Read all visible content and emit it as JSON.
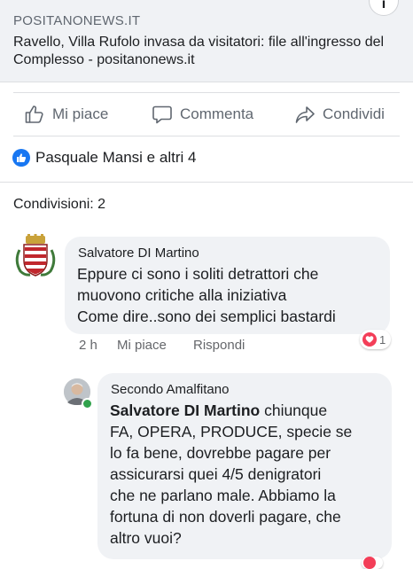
{
  "link_preview": {
    "domain": "POSITANONEWS.IT",
    "title": "Ravello, Villa Rufolo invasa da visitatori: file all'ingresso del Complesso - positanonews.it",
    "info_glyph": "i"
  },
  "actions": {
    "like": "Mi piace",
    "comment": "Commenta",
    "share": "Condividi"
  },
  "reactions": {
    "text": "Pasquale Mansi e altri 4"
  },
  "shares": {
    "text": "Condivisioni: 2"
  },
  "comment1": {
    "author": "Salvatore DI Martino",
    "lines": [
      "Eppure ci sono i soliti detrattori che",
      "muovono critiche alla iniziativa",
      "Come dire..sono dei semplici bastardi"
    ],
    "time": "2 h",
    "like_label": "Mi piace",
    "reply_label": "Rispondi",
    "reaction_count": "1",
    "reaction_color": "#f33e58"
  },
  "comment2": {
    "author": "Secondo Amalfitano",
    "mention": "Salvatore DI Martino",
    "lines": [
      " chiunque",
      "FA, OPERA, PRODUCE, specie se",
      "lo fa bene, dovrebbe pagare per",
      "assicurarsi quei 4/5 denigratori",
      "che ne parlano male. Abbiamo la",
      "fortuna di non doverli pagare, che",
      "altro vuoi?"
    ]
  },
  "colors": {
    "accent": "#1877f2",
    "muted": "#606770",
    "bubble": "#f0f2f5",
    "online": "#31a24c"
  }
}
